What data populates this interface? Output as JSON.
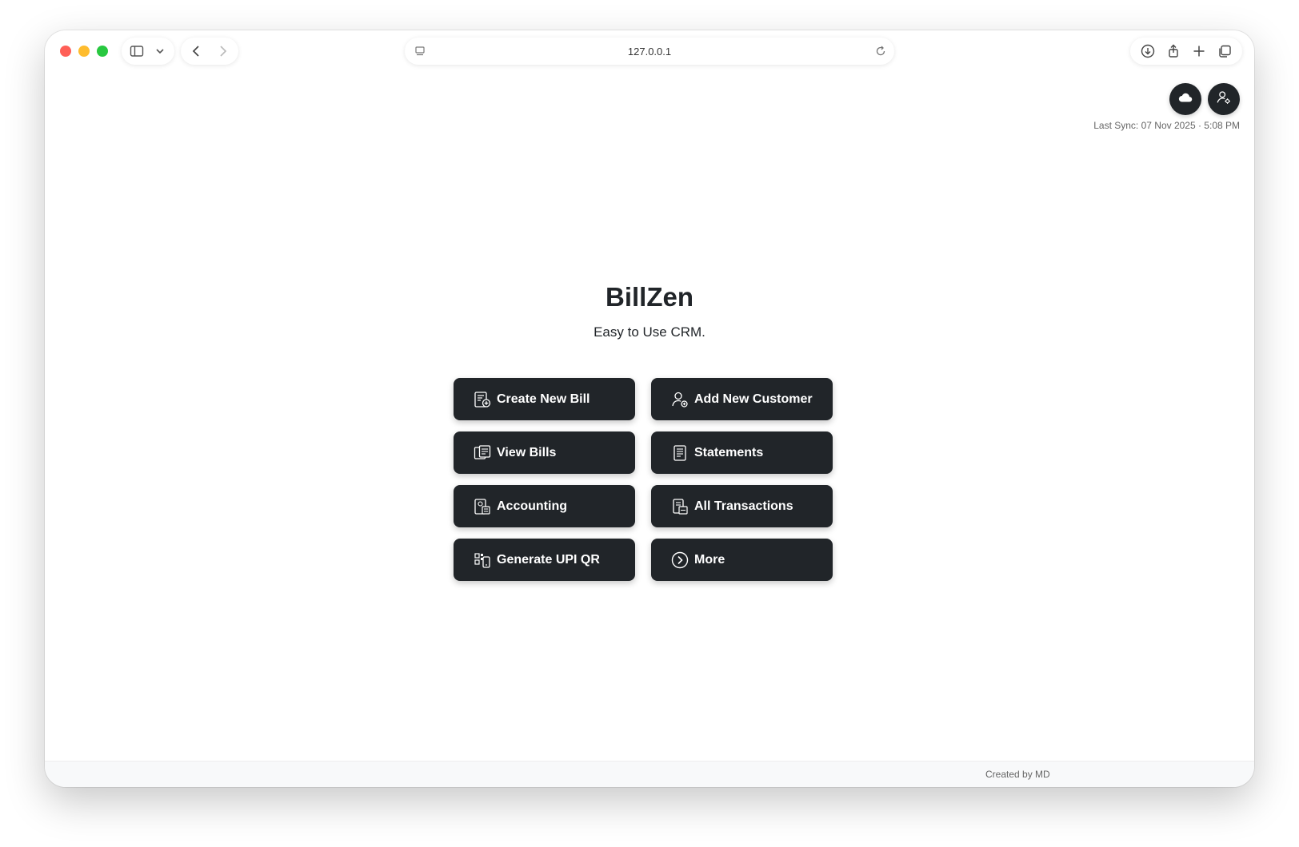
{
  "browser": {
    "url": "127.0.0.1",
    "icons": {
      "sidebar": "sidebar-icon",
      "chevron": "chevron-down-icon",
      "back": "back-icon",
      "forward": "forward-icon",
      "page": "page-icon",
      "reload": "reload-icon",
      "download": "download-icon",
      "share": "share-icon",
      "new_tab": "plus-icon",
      "tabs": "tabs-icon"
    }
  },
  "header": {
    "cloud_icon": "cloud-icon",
    "user_settings_icon": "user-settings-icon",
    "last_sync": "Last Sync: 07 Nov 2025 · 5:08 PM"
  },
  "hero": {
    "title": "BillZen",
    "subtitle": "Easy to Use CRM."
  },
  "menu": {
    "items": [
      {
        "label": "Create New Bill",
        "icon": "create-bill-icon"
      },
      {
        "label": "Add New Customer",
        "icon": "add-customer-icon"
      },
      {
        "label": "View Bills",
        "icon": "view-bills-icon"
      },
      {
        "label": "Statements",
        "icon": "statements-icon"
      },
      {
        "label": "Accounting",
        "icon": "accounting-icon"
      },
      {
        "label": "All Transactions",
        "icon": "transactions-icon"
      },
      {
        "label": "Generate UPI QR",
        "icon": "qr-icon"
      },
      {
        "label": "More",
        "icon": "chevron-right-circle-icon"
      }
    ]
  },
  "footer": {
    "credit": "Created by MD"
  },
  "colors": {
    "button_bg": "#212529",
    "button_text": "#ffffff",
    "traffic_close": "#ff5f57",
    "traffic_min": "#febc2e",
    "traffic_max": "#28c840"
  }
}
